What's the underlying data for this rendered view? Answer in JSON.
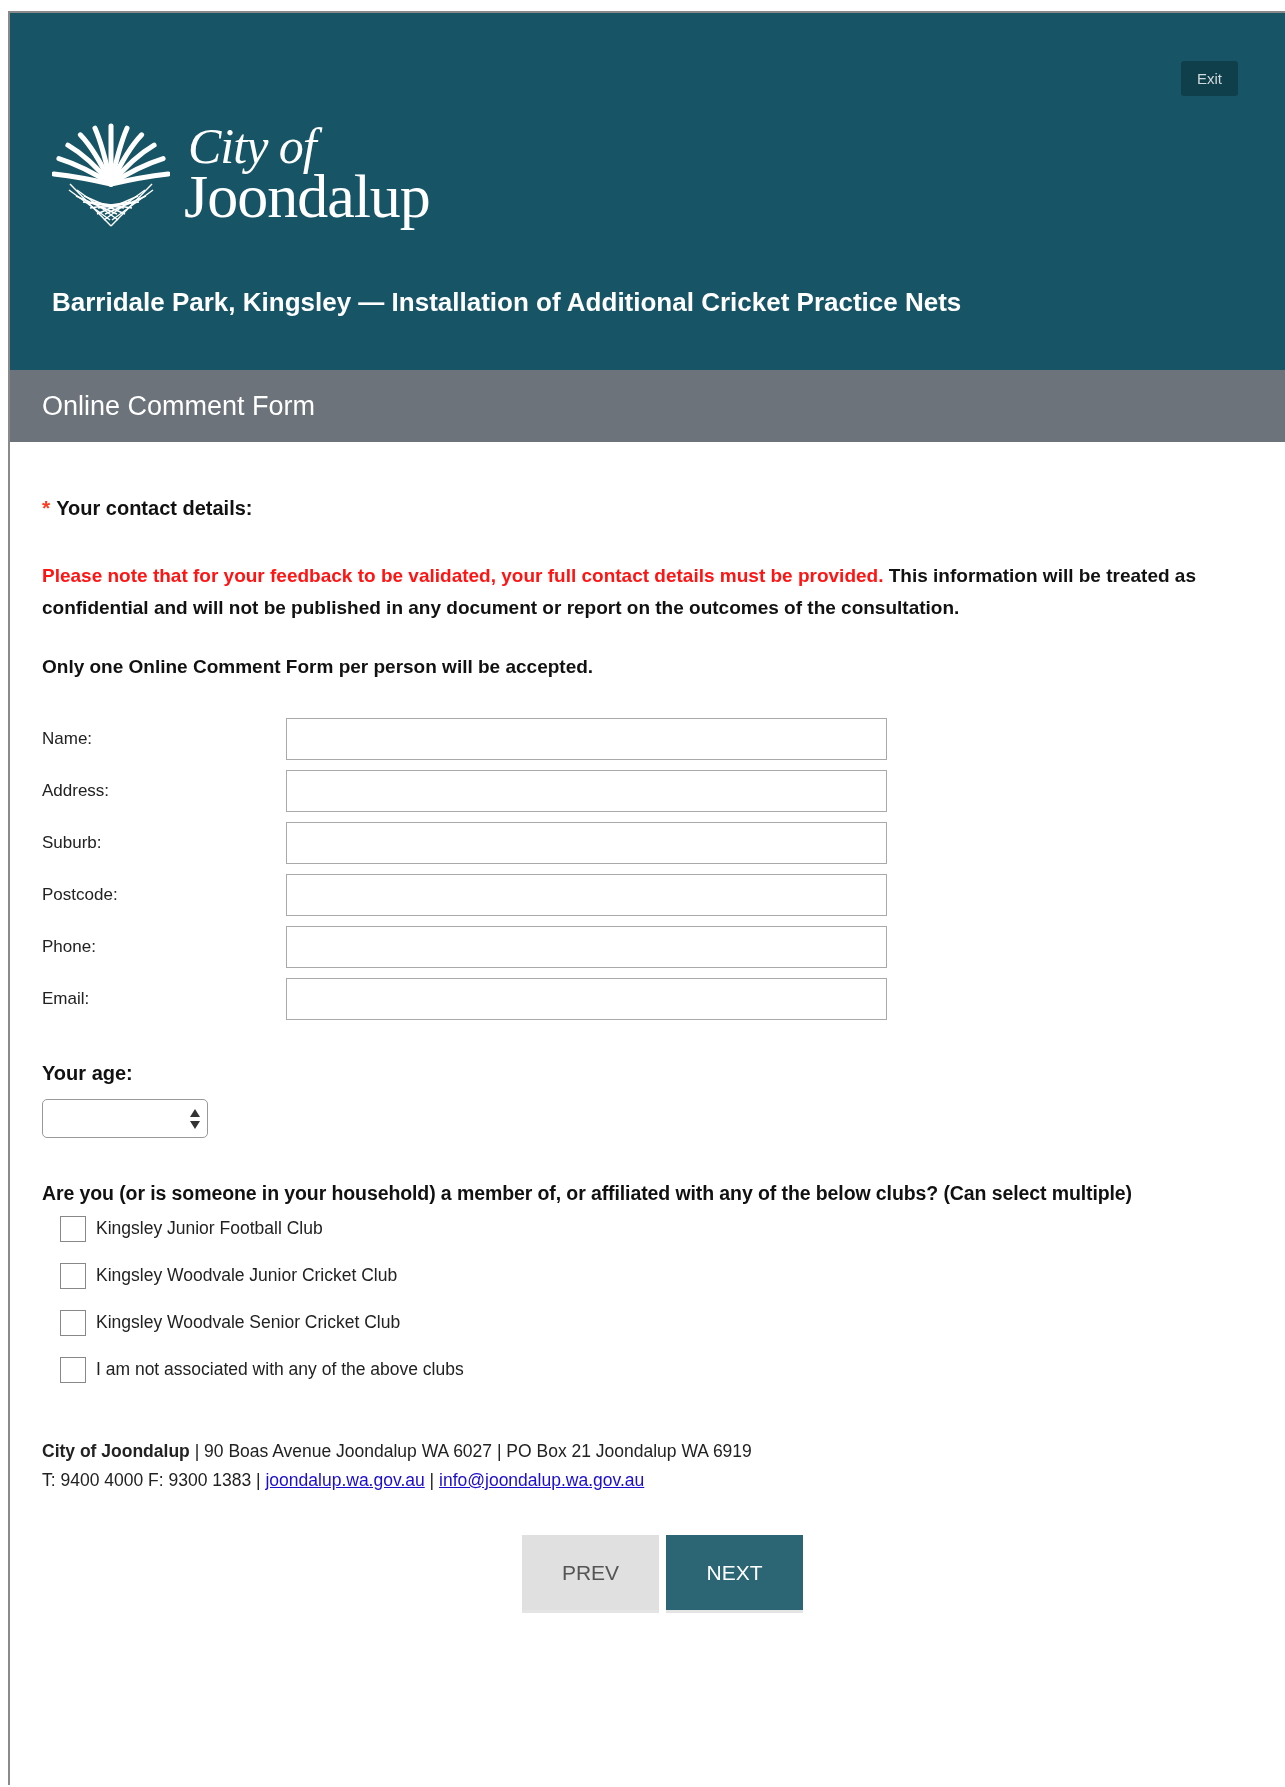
{
  "header": {
    "exit_button": "Exit",
    "logo": {
      "line_1": "City of",
      "line_2": "Joondalup"
    },
    "title": "Barridale Park, Kingsley — Installation of Additional Cricket Practice Nets"
  },
  "form_bar": {
    "title": "Online Comment Form"
  },
  "contact": {
    "required_mark": "*",
    "heading": "Your contact details:",
    "notice": {
      "warning": "Please note that for your feedback to be validated, your full contact details must be provided.",
      "text": "This information will be treated as confidential and will not be published in any document or report on the outcomes of the consultation."
    },
    "rule": "Only one Online Comment Form per person will be accepted."
  },
  "fields": [
    {
      "label": "Name:"
    },
    {
      "label": "Address:"
    },
    {
      "label": "Suburb:"
    },
    {
      "label": "Postcode:"
    },
    {
      "label": "Phone:"
    },
    {
      "label": "Email:"
    }
  ],
  "age": {
    "label": "Your age:"
  },
  "clubs": {
    "question": "Are you (or is someone in your household) a member of, or affiliated with any of the below clubs? (Can select multiple)",
    "options": [
      {
        "label": "Kingsley Junior Football Club",
        "checked": false
      },
      {
        "label": "Kingsley Woodvale Junior Cricket Club",
        "checked": false
      },
      {
        "label": "Kingsley Woodvale Senior Cricket Club",
        "checked": false
      },
      {
        "label": "I am not associated with any of the above clubs",
        "checked": false
      }
    ]
  },
  "footer": {
    "address": "**City of Joondalup** | 90 Boas Avenue Joondalup WA 6027 | PO Box 21 Joondalup WA 6919",
    "contact": [
      {
        "kind": "text",
        "text": "T: 9400 4000 F: 9300 1383 |"
      },
      {
        "kind": "link",
        "text": "joondalup.wa.gov.au"
      },
      {
        "kind": "text",
        "text": "|"
      },
      {
        "kind": "link",
        "text": "info@joondalup.wa.gov.au"
      }
    ]
  },
  "buttons": [
    {
      "label": "PREV",
      "kind": "secondary"
    },
    {
      "label": "NEXT",
      "kind": "primary"
    }
  ]
}
